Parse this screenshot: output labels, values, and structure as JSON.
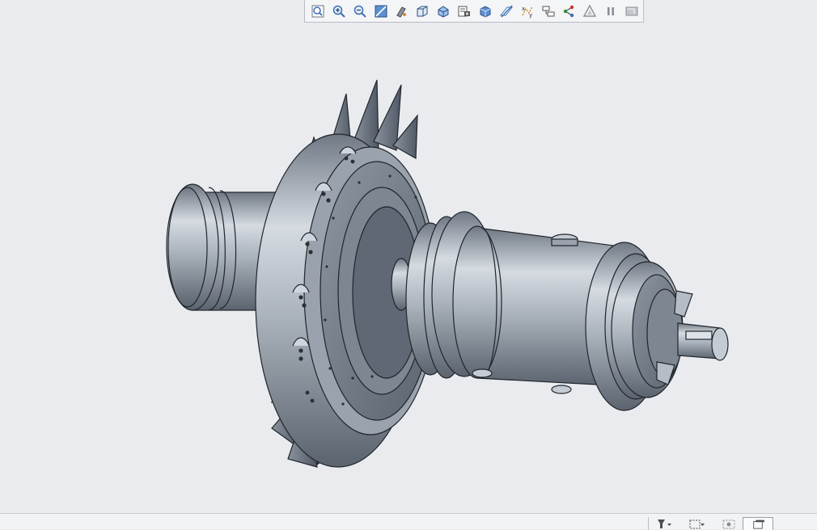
{
  "toolbar": {
    "tools": [
      {
        "icon": "refit-view-icon"
      },
      {
        "icon": "zoom-in-icon"
      },
      {
        "icon": "zoom-out-icon"
      },
      {
        "icon": "repaint-icon"
      },
      {
        "icon": "display-style-icon"
      },
      {
        "icon": "standard-orientation-icon"
      },
      {
        "icon": "saved-views-icon"
      },
      {
        "icon": "view-manager-icon"
      },
      {
        "icon": "section-view-icon"
      },
      {
        "icon": "datum-display-icon"
      },
      {
        "icon": "annotation-display-icon"
      },
      {
        "icon": "spin-center-icon"
      },
      {
        "icon": "tree-connect-icon"
      },
      {
        "icon": "appearance-icon"
      },
      {
        "icon": "pause-icon"
      },
      {
        "icon": "hide-toolbar-icon"
      }
    ]
  },
  "colors": {
    "background": "#e9ebee",
    "metal_light": "#c7ced6",
    "metal_mid": "#9aa3ad",
    "metal_dark": "#5b6470",
    "edge": "#20252b"
  },
  "statusbar": {
    "items": [
      {
        "icon": "filter-dropdown-icon"
      },
      {
        "icon": "selection-box-icon"
      },
      {
        "icon": "smart-select-icon"
      },
      {
        "icon": "graphics-window-icon"
      }
    ]
  }
}
